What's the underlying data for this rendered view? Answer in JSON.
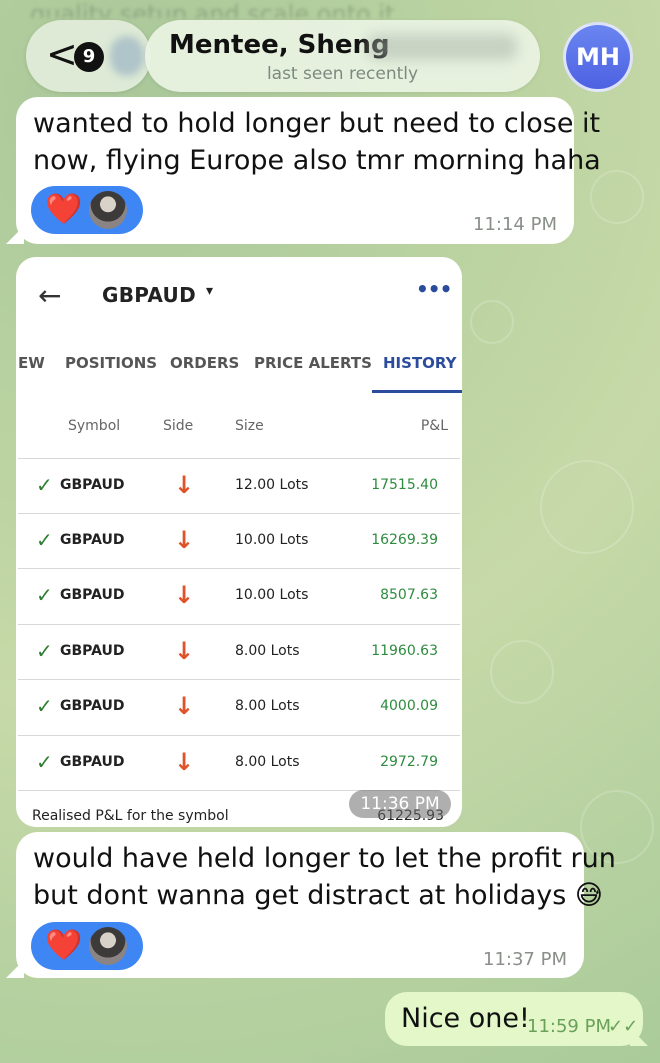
{
  "header": {
    "top_blurred_text": "quality setup and scale onto it",
    "back_badge": "9",
    "back_chevron": "<",
    "contact_name": "Mentee, Sheng",
    "status": "last seen recently",
    "avatar_initials": "MH"
  },
  "messages": [
    {
      "text_line1": "wanted to hold longer but need to close it",
      "text_line2": "now, flying Europe also tmr morning haha",
      "time": "11:14 PM",
      "reaction": "❤️"
    },
    {
      "time": "11:36 PM"
    },
    {
      "text_line1": "would have held longer to let the profit run",
      "text_line2": "but dont wanna get distract at holidays 😅",
      "time": "11:37 PM",
      "reaction": "❤️"
    },
    {
      "text": "Nice one!",
      "time": "11:59 PM",
      "status": "✓✓"
    }
  ],
  "trade_screenshot": {
    "back": "←",
    "symbol": "GBPAUD",
    "caret": "▾",
    "more": "•••",
    "tabs": [
      "EW",
      "POSITIONS",
      "ORDERS",
      "PRICE ALERTS",
      "HISTORY"
    ],
    "active_tab": "HISTORY",
    "columns": [
      "Symbol",
      "Side",
      "Size",
      "P&L"
    ],
    "rows": [
      {
        "check": "✓",
        "symbol": "GBPAUD",
        "side": "↓",
        "size": "12.00 Lots",
        "pnl": "17515.40"
      },
      {
        "check": "✓",
        "symbol": "GBPAUD",
        "side": "↓",
        "size": "10.00 Lots",
        "pnl": "16269.39"
      },
      {
        "check": "✓",
        "symbol": "GBPAUD",
        "side": "↓",
        "size": "10.00 Lots",
        "pnl": "8507.63"
      },
      {
        "check": "✓",
        "symbol": "GBPAUD",
        "side": "↓",
        "size": "8.00 Lots",
        "pnl": "11960.63"
      },
      {
        "check": "✓",
        "symbol": "GBPAUD",
        "side": "↓",
        "size": "8.00 Lots",
        "pnl": "4000.09"
      },
      {
        "check": "✓",
        "symbol": "GBPAUD",
        "side": "↓",
        "size": "8.00 Lots",
        "pnl": "2972.79"
      }
    ],
    "footer_label": "Realised P&L for the symbol",
    "footer_value": "61225.93"
  },
  "colors": {
    "accent_blue": "#2b4c9c",
    "profit_green": "#2e8b3f",
    "sell_arrow": "#e0532a",
    "reaction_blue": "#3f86f5",
    "outgoing_bubble": "#e3f7c9"
  }
}
